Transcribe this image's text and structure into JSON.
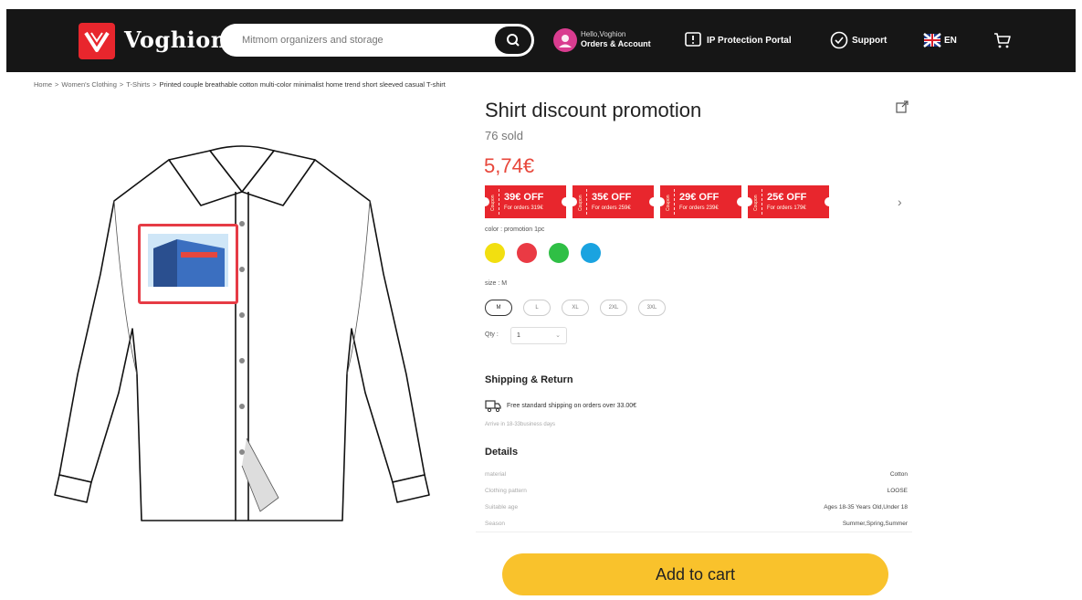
{
  "header": {
    "brand": "Voghion",
    "search_placeholder": "Mitmom organizers and storage",
    "account_line1": "Hello,Voghion",
    "account_line2": "Orders & Account",
    "ip_portal": "IP Protection Portal",
    "support": "Support",
    "language": "EN",
    "icons": [
      "logo-icon",
      "search-icon",
      "user-avatar",
      "shield-icon",
      "chat-icon",
      "flag-icon",
      "cart-icon"
    ]
  },
  "breadcrumb": [
    "Home",
    ">",
    "Women's Clothing",
    ">",
    "T-Shirts",
    ">",
    "Printed couple breathable cotton multi-color minimalist home trend short sleeved casual T-shirt"
  ],
  "product": {
    "title": "Shirt discount promotion",
    "sold": "76 sold",
    "price": "5,74€",
    "coupons": [
      {
        "value": "39€ OFF",
        "condition": "For orders 319€",
        "side": "Coupon"
      },
      {
        "value": "35€ OFF",
        "condition": "For orders 259€",
        "side": "Coupon"
      },
      {
        "value": "29€ OFF",
        "condition": "For orders 239€",
        "side": "Coupon"
      },
      {
        "value": "25€ OFF",
        "condition": "For orders 179€",
        "side": "Coupon"
      }
    ],
    "color_label": "color : promotion 1pc",
    "swatches": [
      "#f2df10",
      "#ea3a44",
      "#2fbf45",
      "#1aa3e0"
    ],
    "size_label": "size : M",
    "sizes": [
      "M",
      "L",
      "XL",
      "2XL",
      "3XL"
    ],
    "selected_size": "M",
    "qty_label": "Qty :",
    "qty_value": "1"
  },
  "shipping": {
    "title": "Shipping & Return",
    "line": "Free standard shipping on orders over 33.00€",
    "arrive": "Arrive in 18-33business days"
  },
  "details": {
    "title": "Details",
    "rows": [
      {
        "k": "material",
        "v": "Cotton"
      },
      {
        "k": "Clothing pattern",
        "v": "LOOSE"
      },
      {
        "k": "Suitable age",
        "v": "Ages 18-35 Years Old,Under 18"
      },
      {
        "k": "Season",
        "v": "Summer,Spring,Summer"
      }
    ]
  },
  "actions": {
    "add_to_cart": "Add to cart"
  },
  "colors": {
    "header_bg": "#161616",
    "brand_red": "#e8262d",
    "price_red": "#e8473b",
    "cart_yellow": "#f9c22c"
  }
}
